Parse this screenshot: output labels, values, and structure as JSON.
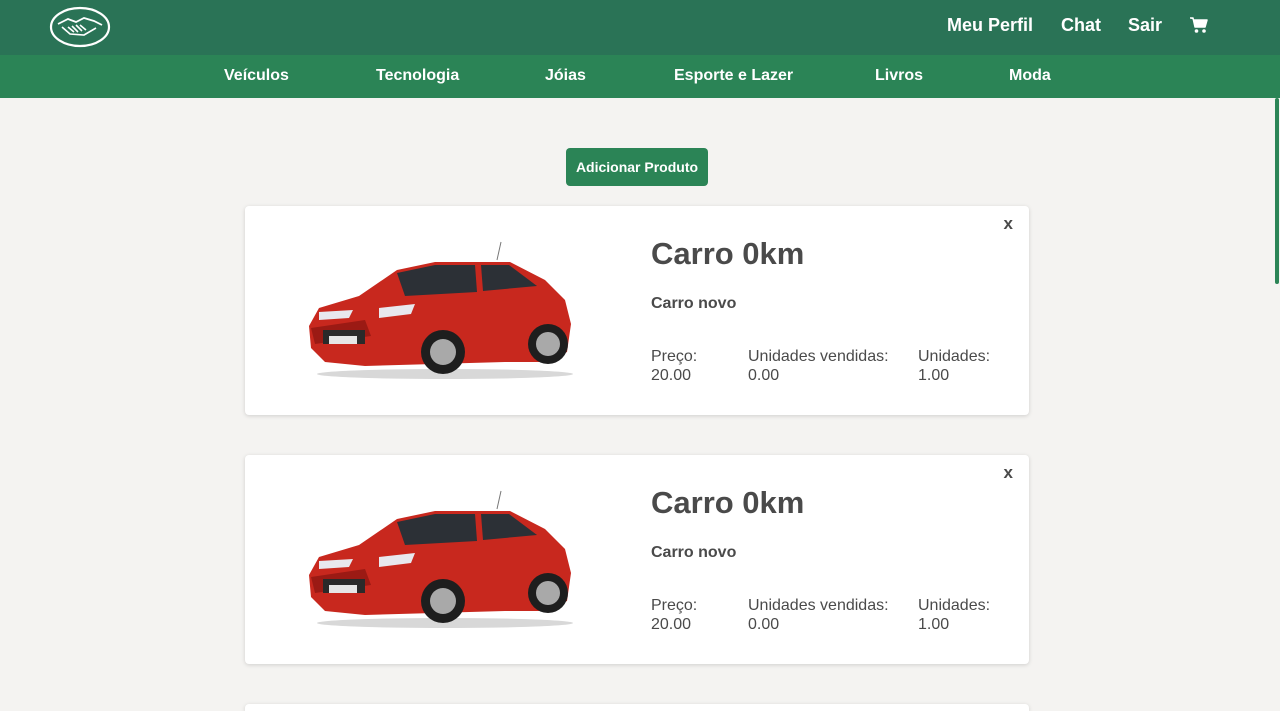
{
  "header": {
    "logo_icon": "handshake-icon",
    "links": {
      "profile": "Meu Perfil",
      "chat": "Chat",
      "logout": "Sair"
    },
    "cart_icon": "cart-icon",
    "colors": {
      "topbar": "#2a7356",
      "catbar": "#2b8456"
    }
  },
  "categories": [
    "Veículos",
    "Tecnologia",
    "Jóias",
    "Esporte e Lazer",
    "Livros",
    "Moda"
  ],
  "actions": {
    "add_product": "Adicionar Produto"
  },
  "products": [
    {
      "close": "x",
      "title": "Carro 0km",
      "description": "Carro novo",
      "price_label": "Preço:",
      "price": "20.00",
      "sold_label": "Unidades vendidas:",
      "sold": "0.00",
      "units_label": "Unidades:",
      "units": "1.00",
      "image_icon": "red-car-image"
    },
    {
      "close": "x",
      "title": "Carro 0km",
      "description": "Carro novo",
      "price_label": "Preço:",
      "price": "20.00",
      "sold_label": "Unidades vendidas:",
      "sold": "0.00",
      "units_label": "Unidades:",
      "units": "1.00",
      "image_icon": "red-car-image"
    }
  ]
}
